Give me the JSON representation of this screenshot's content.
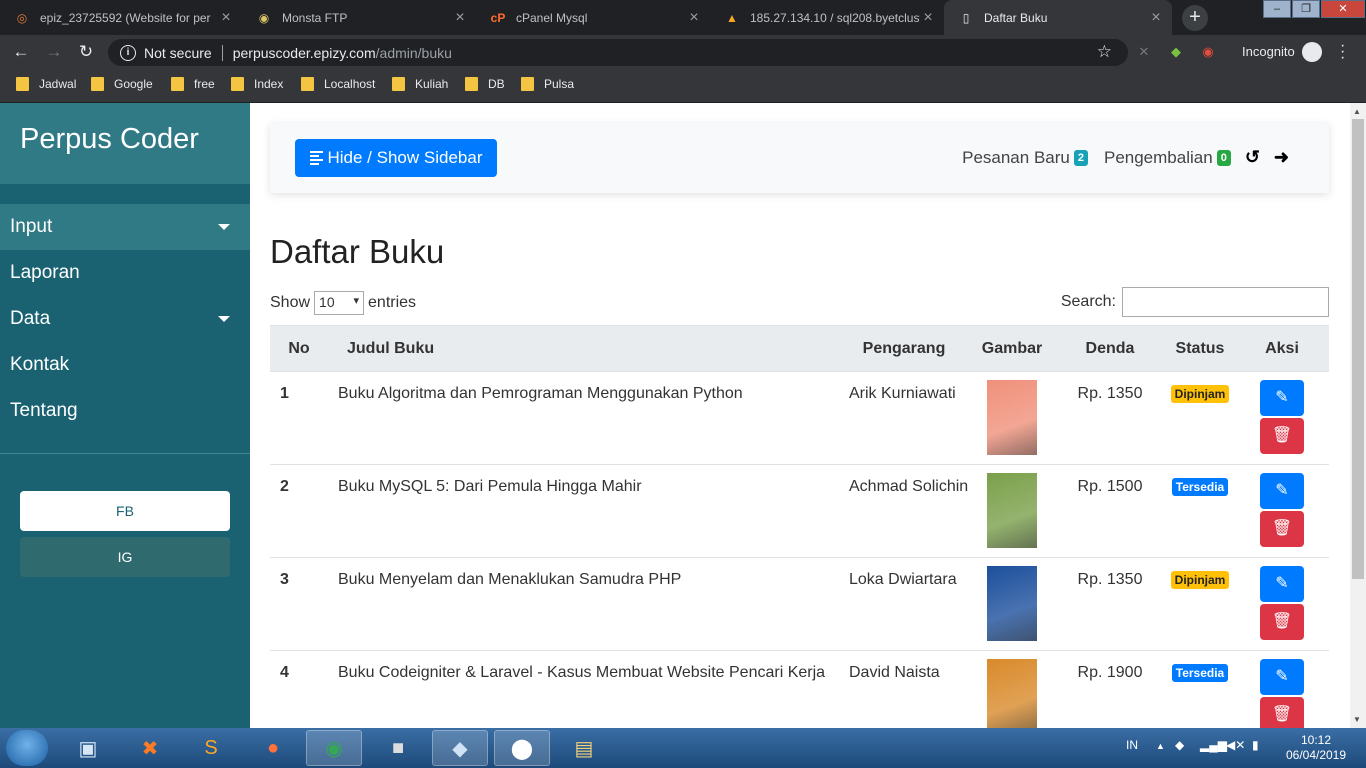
{
  "browser": {
    "tabs": [
      {
        "title": "epiz_23725592 (Website for per",
        "icon": "cp-icon",
        "active": false
      },
      {
        "title": "Monsta FTP",
        "icon": "monsta-icon",
        "active": false
      },
      {
        "title": "cPanel Mysql",
        "icon": "cpanel-icon",
        "active": false
      },
      {
        "title": "185.27.134.10 / sql208.byetclust",
        "icon": "pma-icon",
        "active": false
      },
      {
        "title": "Daftar Buku",
        "icon": "page-icon",
        "active": true
      }
    ],
    "security_label": "Not secure",
    "url_host": "perpuscoder.epizy.com",
    "url_path": "/admin/buku",
    "incognito_label": "Incognito",
    "bookmarks": [
      "Jadwal",
      "Google",
      "free",
      "Index",
      "Localhost",
      "Kuliah",
      "DB",
      "Pulsa"
    ]
  },
  "sidebar": {
    "brand": "Perpus Coder",
    "items": [
      {
        "label": "Input",
        "dropdown": true
      },
      {
        "label": "Laporan",
        "dropdown": false
      },
      {
        "label": "Data",
        "dropdown": true
      },
      {
        "label": "Kontak",
        "dropdown": false
      },
      {
        "label": "Tentang",
        "dropdown": false
      }
    ],
    "fb_label": "FB",
    "ig_label": "IG"
  },
  "topnav": {
    "toggle_label": "Hide / Show Sidebar",
    "pesanan_label": "Pesanan Baru",
    "pesanan_count": "2",
    "pengembalian_label": "Pengembalian",
    "pengembalian_count": "0"
  },
  "page": {
    "title": "Daftar Buku",
    "show_label": "Show",
    "entries_value": "10",
    "entries_label": "entries",
    "search_label": "Search:",
    "search_value": ""
  },
  "table": {
    "headers": [
      "No",
      "Judul Buku",
      "Pengarang",
      "Gambar",
      "Denda",
      "Status",
      "Aksi"
    ],
    "rows": [
      {
        "no": "1",
        "judul": "Buku Algoritma dan Pemrograman Menggunakan Python",
        "pengarang": "Arik Kurniawati",
        "denda": "Rp. 1350",
        "status": "Dipinjam",
        "cover": "#f0907a"
      },
      {
        "no": "2",
        "judul": "Buku MySQL 5: Dari Pemula Hingga Mahir",
        "pengarang": "Achmad Solichin",
        "denda": "Rp. 1500",
        "status": "Tersedia",
        "cover": "#7aa04a"
      },
      {
        "no": "3",
        "judul": "Buku Menyelam dan Menaklukan Samudra PHP",
        "pengarang": "Loka Dwiartara",
        "denda": "Rp. 1350",
        "status": "Dipinjam",
        "cover": "#1c4f9c"
      },
      {
        "no": "4",
        "judul": "Buku Codeigniter & Laravel - Kasus Membuat Website Pencari Kerja",
        "pengarang": "David Naista",
        "denda": "Rp. 1900",
        "status": "Tersedia",
        "cover": "#d98a2a"
      }
    ]
  },
  "taskbar": {
    "lang": "IN",
    "time": "10:12",
    "date": "06/04/2019"
  },
  "colors": {
    "sidebar": "#1a6271",
    "primary": "#007bff",
    "danger": "#dc3545",
    "warning": "#ffc107",
    "success": "#28a745",
    "info": "#17a2b8"
  }
}
